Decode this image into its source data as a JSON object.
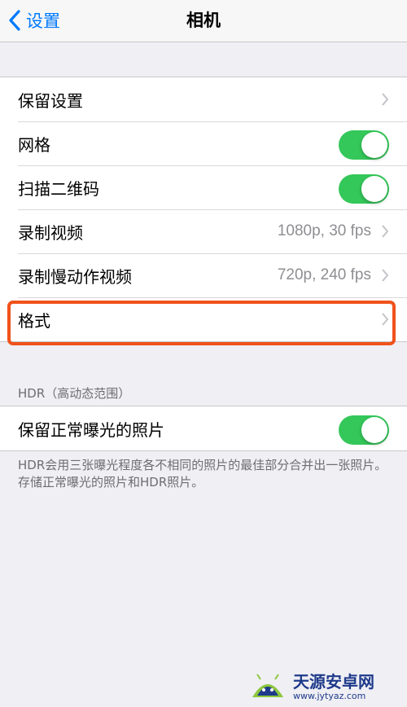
{
  "navbar": {
    "back_label": "设置",
    "title": "相机"
  },
  "group1": {
    "rows": [
      {
        "label": "保留设置",
        "accessory": "chevron"
      },
      {
        "label": "网格",
        "accessory": "toggle",
        "on": true
      },
      {
        "label": "扫描二维码",
        "accessory": "toggle",
        "on": true
      },
      {
        "label": "录制视频",
        "accessory": "chevron",
        "value": "1080p, 30 fps"
      },
      {
        "label": "录制慢动作视频",
        "accessory": "chevron",
        "value": "720p, 240 fps"
      },
      {
        "label": "格式",
        "accessory": "chevron",
        "highlighted": true
      }
    ]
  },
  "hdr": {
    "header": "HDR（高动态范围）",
    "row": {
      "label": "保留正常曝光的照片",
      "accessory": "toggle",
      "on": true
    },
    "footer": "HDR会用三张曝光程度各不相同的照片的最佳部分合并出一张照片。存储正常曝光的照片和HDR照片。"
  },
  "watermark": {
    "name": "天源安卓网",
    "url": "www.jytyaz.com"
  },
  "colors": {
    "accent": "#007aff",
    "toggle_on": "#34c759",
    "highlight": "#f0521c"
  }
}
